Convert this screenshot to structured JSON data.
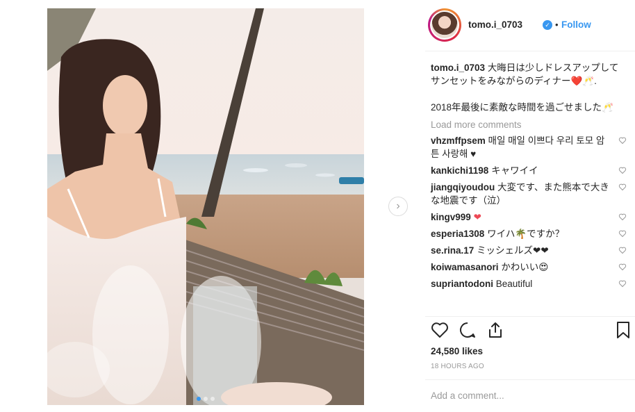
{
  "post": {
    "username": "tomo.i_0703",
    "follow_label": "Follow",
    "dot": "•",
    "caption_lines": [
      "大晦日は少しドレスアップして",
      "サンセットをみながらのディナー❤️🥂.",
      "2018年最後に素敵な時間を過ごせました🥂"
    ],
    "load_more": "Load more comments",
    "comments": [
      {
        "user": "vhzmffpsem",
        "text": "매일 매일 이쁘다 우리 토모 암튼 사랑해 ♥"
      },
      {
        "user": "kankichi1198",
        "text": "キャワイイ"
      },
      {
        "user": "jiangqiyoudou",
        "text": "大変です、また熊本で大きな地震です（泣）"
      },
      {
        "user": "kingv999",
        "text": "❤"
      },
      {
        "user": "esperia1308",
        "text": "ワイハ🌴ですか？"
      },
      {
        "user": "se.rina.17",
        "text": "ミッシェルズ❤❤"
      },
      {
        "user": "koiwamasanori",
        "text": "かわいい😍"
      },
      {
        "user": "supriantodoni",
        "text": "Beautiful"
      }
    ],
    "likes": "24,580 likes",
    "time": "18 HOURS AGO",
    "add_comment_placeholder": "Add a comment...",
    "icons": {
      "like": "heart-icon",
      "comment": "comment-icon",
      "share": "share-icon",
      "save": "bookmark-icon",
      "next": "chevron-right-icon",
      "verified": "verified-badge-icon"
    },
    "next_glyph": "›",
    "verified_glyph": "✓"
  },
  "colors": {
    "accent": "#3897f0",
    "text": "#262626",
    "muted": "#999999",
    "divider": "#efefef"
  }
}
